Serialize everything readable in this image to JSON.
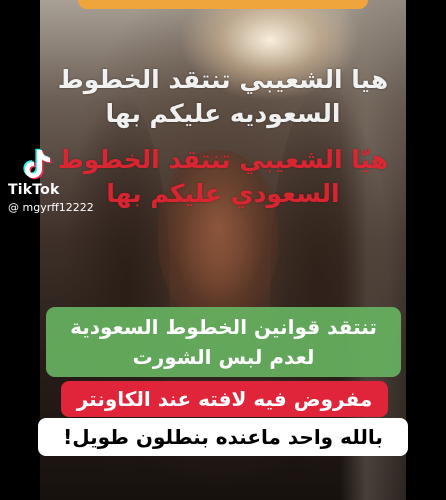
{
  "overlay_text": {
    "white_line_1": "هيا الشعيبي تنتقد الخطوط",
    "white_line_2": "السعوديه عليكم بها",
    "red_line_1": "هيّا الشعيبي تنتقد الخطوط",
    "red_line_2": "السعودي عليكم بها"
  },
  "watermark": {
    "brand": "TikTok",
    "handle": "@ mgyrff12222",
    "icon": "tiktok-logo-icon"
  },
  "captions": {
    "green_line_1": "تنتقد قوانين الخطوط السعودية",
    "green_line_2": "لعدم لبس الشورت",
    "red": "مفروض فيه لافته عند الكاونتر",
    "white": "بالله واحد ماعنده بنطلون طويل!"
  },
  "colors": {
    "green_caption_bg": "#66b060",
    "red_caption_bg": "#e0243a",
    "white_caption_bg": "#ffffff",
    "top_banner": "#f0a43c",
    "red_overlay_text": "#e82634"
  }
}
